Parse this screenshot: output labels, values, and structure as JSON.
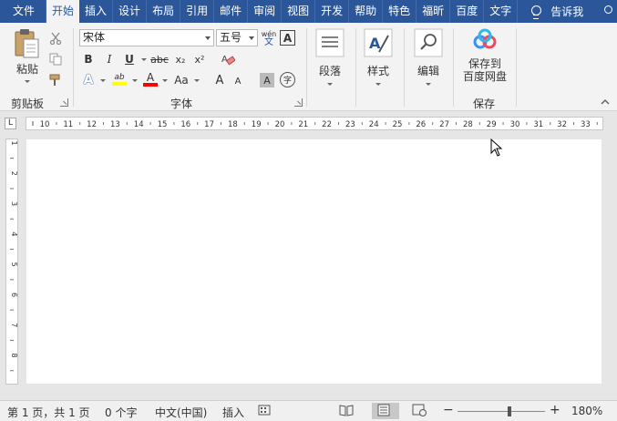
{
  "tabs": [
    {
      "label": "文件"
    },
    {
      "label": "开始",
      "active": true
    },
    {
      "label": "插入"
    },
    {
      "label": "设计"
    },
    {
      "label": "布局"
    },
    {
      "label": "引用"
    },
    {
      "label": "邮件"
    },
    {
      "label": "审阅"
    },
    {
      "label": "视图"
    },
    {
      "label": "开发"
    },
    {
      "label": "帮助"
    },
    {
      "label": "特色"
    },
    {
      "label": "福昕"
    },
    {
      "label": "百度"
    },
    {
      "label": "文字"
    }
  ],
  "tell_me": "告诉我",
  "clipboard": {
    "paste_label": "粘贴",
    "group_label": "剪贴板"
  },
  "font": {
    "name": "宋体",
    "size": "五号",
    "phonetic_top": "wén",
    "phonetic_bottom": "文",
    "bold": "B",
    "italic": "I",
    "underline": "U",
    "strike": "abc",
    "subscript": "x₂",
    "superscript": "x²",
    "text_effect": "A",
    "highlight": "ab",
    "font_color": "A",
    "change_case": "Aa",
    "grow": "A",
    "shrink": "A",
    "char_shading": "A",
    "enclose": "字",
    "char_border": "A",
    "group_label": "字体"
  },
  "paragraph": {
    "label": "段落"
  },
  "styles": {
    "label": "样式"
  },
  "editing": {
    "label": "编辑"
  },
  "baidu": {
    "label_line1": "保存到",
    "label_line2": "百度网盘",
    "group_label": "保存"
  },
  "ruler": {
    "tab_selector": "L",
    "h_labels": [
      "10",
      "11",
      "12",
      "13",
      "14",
      "15",
      "16",
      "17",
      "18",
      "19",
      "20",
      "21",
      "22",
      "23",
      "24",
      "25",
      "26",
      "27",
      "28",
      "29",
      "30",
      "31",
      "32",
      "33"
    ],
    "v_labels": [
      "1",
      "2",
      "3",
      "4",
      "5",
      "6",
      "7",
      "8",
      "9"
    ]
  },
  "status": {
    "page": "第 1 页，共 1 页",
    "words": "0 个字",
    "language": "中文(中国)",
    "mode": "插入",
    "zoom": "180%",
    "zoom_out": "−",
    "zoom_in": "+"
  },
  "colors": {
    "accent": "#2b579a",
    "highlight": "#ffff00",
    "font_color": "#ff0000"
  }
}
